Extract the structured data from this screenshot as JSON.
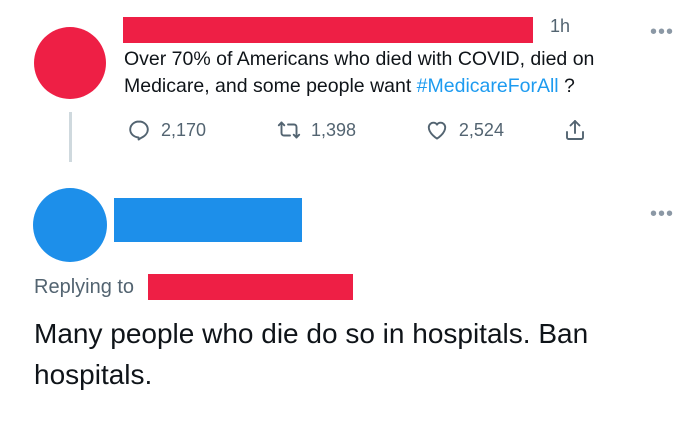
{
  "colors": {
    "redaction": "#ee1f45",
    "avatar_1": "#ee1f45",
    "avatar_2": "#1d8fea",
    "name_block_2": "#1d8fea",
    "hashtag": "#1d9bf0",
    "secondary_text": "#536471"
  },
  "tweet": {
    "time": "1h",
    "more_label": "•••",
    "text_before": "Over 70% of Americans who died with COVID, died on Medicare, and some people want ",
    "hashtag": "#MedicareForAll",
    "text_after": " ?",
    "actions": {
      "reply_icon": "reply-icon",
      "reply_count": "2,170",
      "retweet_icon": "retweet-icon",
      "retweet_count": "1,398",
      "like_icon": "heart-icon",
      "like_count": "2,524",
      "share_icon": "share-icon"
    }
  },
  "reply": {
    "more_label": "•••",
    "replying_to_label": "Replying to",
    "text": "Many people who die do so in hospitals. Ban hospitals."
  }
}
